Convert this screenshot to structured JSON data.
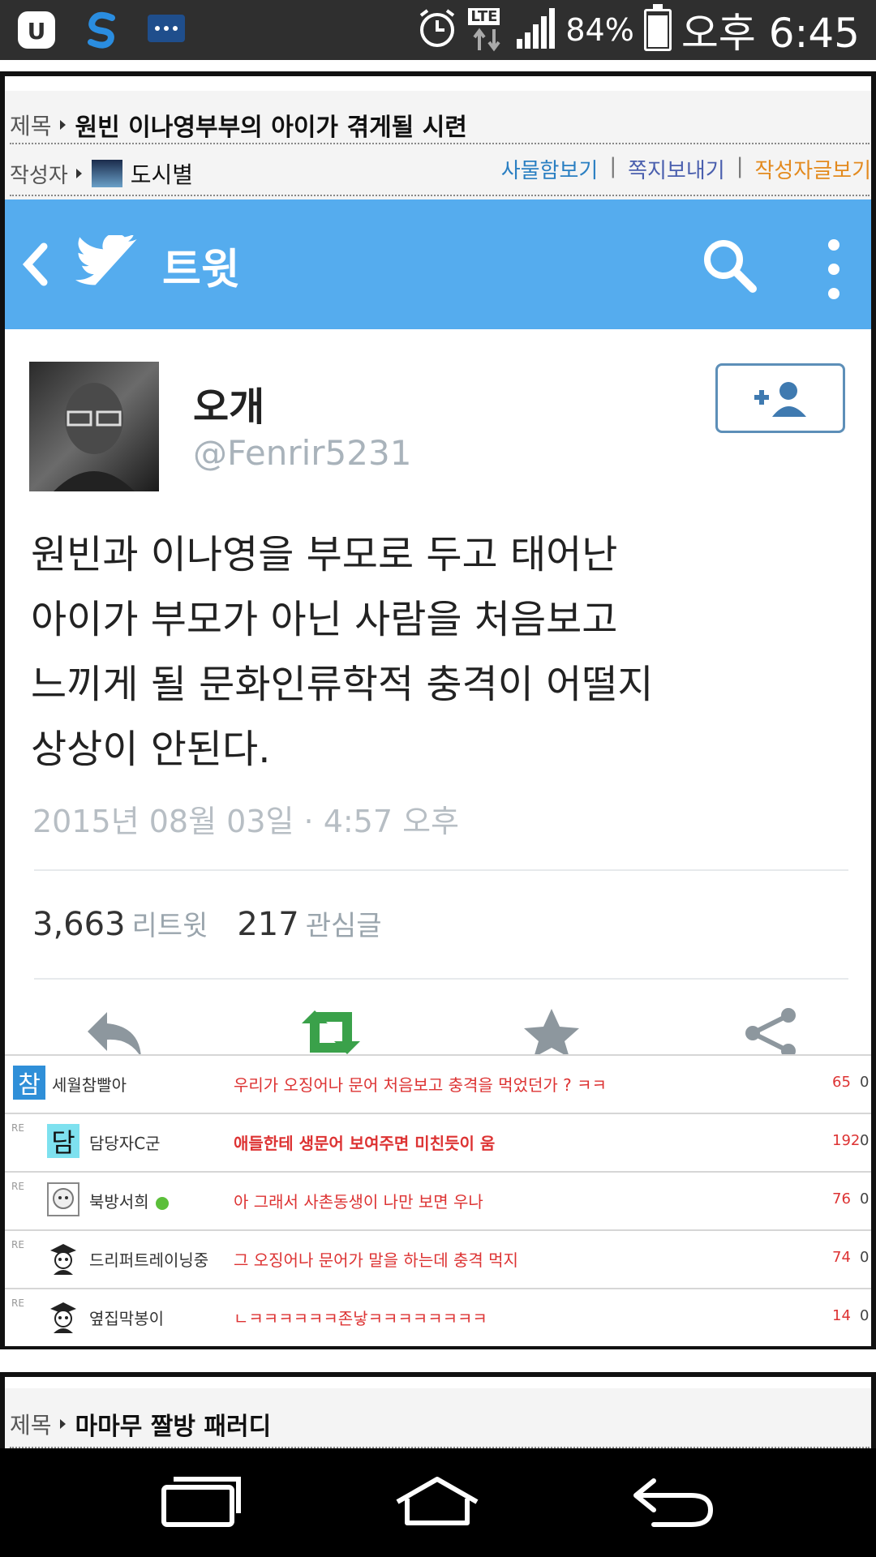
{
  "status_bar": {
    "lte": "LTE",
    "battery": "84%",
    "battery_level": 0.84,
    "time": "오후 6:45"
  },
  "post": {
    "title_label": "제목",
    "title": "원빈 이나영부부의 아이가 겪게될 시련",
    "author_label": "작성자",
    "author_name": "도시별",
    "links": [
      "사물함보기",
      "쪽지보내기",
      "작성자글보기"
    ],
    "link_sep": "|"
  },
  "twitter": {
    "header_title": "트윗",
    "user_name": "오개",
    "user_handle": "@Fenrir5231",
    "tweet_lines": [
      "원빈과 이나영을 부모로 두고 태어난",
      "아이가 부모가 아닌 사람을 처음보고",
      "느끼게 될 문화인류학적 충격이 어떨지",
      "상상이 안된다."
    ],
    "timestamp": "2015년 08월 03일 · 4:57 오후",
    "retweets": "3,663",
    "retweets_label": "리트윗",
    "likes": "217",
    "likes_label": "관심글",
    "colors": {
      "brand": "#55acee",
      "retweet_green": "#3aa14a"
    }
  },
  "comments": [
    {
      "reply": "",
      "nickname": "세월참빨아",
      "avatar_text": "참",
      "text": "우리가 오징어나 문어 처음보고 충격을 먹었던가 ? ㅋㅋ",
      "count": "65",
      "zero": "0",
      "bold": false
    },
    {
      "reply": "RE",
      "nickname": "담당자C군",
      "avatar_text": "담",
      "text": "애들한테 생문어 보여주면 미친듯이 움",
      "count": "192",
      "zero": "0",
      "bold": true
    },
    {
      "reply": "RE",
      "nickname": "북방서희",
      "avatar_text": "",
      "text": "아 그래서 사촌동생이 나만 보면 우나",
      "count": "76",
      "zero": "0",
      "bold": false
    },
    {
      "reply": "RE",
      "nickname": "드리퍼트레이닝중",
      "avatar_text": "",
      "text": "그 오징어나 문어가 말을 하는데 충격 먹지",
      "count": "74",
      "zero": "0",
      "bold": false
    },
    {
      "reply": "RE",
      "nickname": "옆집막봉이",
      "avatar_text": "",
      "text": "ㄴㅋㅋㅋㅋㅋㅋ존낳ㅋㅋㅋㅋㅋㅋㅋㅋ",
      "count": "14",
      "zero": "0",
      "bold": false
    }
  ],
  "next_post": {
    "title_label": "제목",
    "title": "마마무 짤방 패러디"
  }
}
